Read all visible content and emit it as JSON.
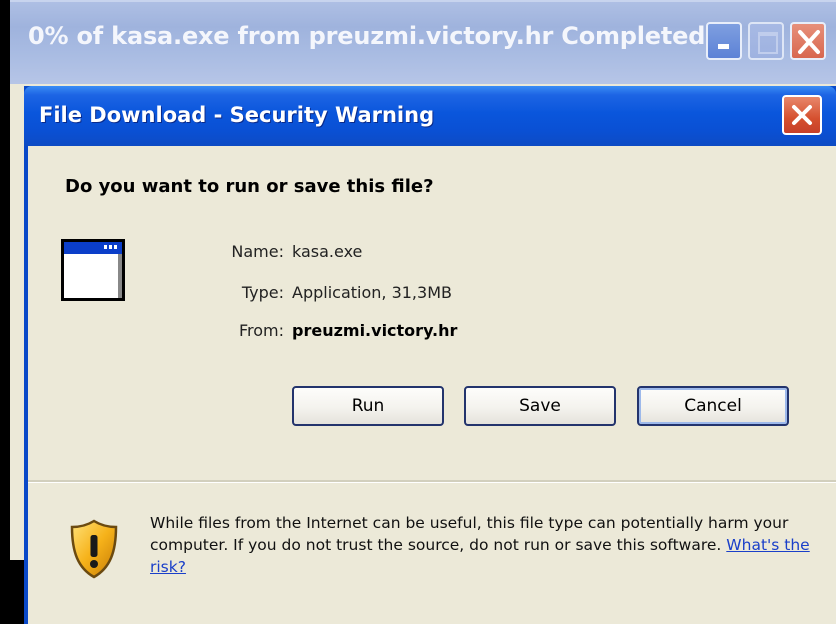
{
  "background_window": {
    "title": "0% of kasa.exe from preuzmi.victory.hr Completed",
    "buttons": [
      "minimize",
      "maximize",
      "close"
    ]
  },
  "dialog": {
    "title": "File Download - Security Warning",
    "question": "Do you want to run or save this file?",
    "file_icon": "application-window-icon",
    "fields": {
      "name_label": "Name:",
      "name_value": "kasa.exe",
      "type_label": "Type:",
      "type_value": "Application, 31,3MB",
      "from_label": "From:",
      "from_value": "preuzmi.victory.hr"
    },
    "buttons": {
      "run": "Run",
      "save": "Save",
      "cancel": "Cancel"
    },
    "warning": {
      "icon": "shield-warning-icon",
      "text": "While files from the Internet can be useful, this file type can potentially harm your computer. If you do not trust the source, do not run or save this software.",
      "link": "What's the risk?"
    }
  },
  "colors": {
    "title_bar": "#0a56dc",
    "dialog_face": "#ece9d8",
    "close_button": "#d5502f",
    "link": "#1a3fc9"
  }
}
